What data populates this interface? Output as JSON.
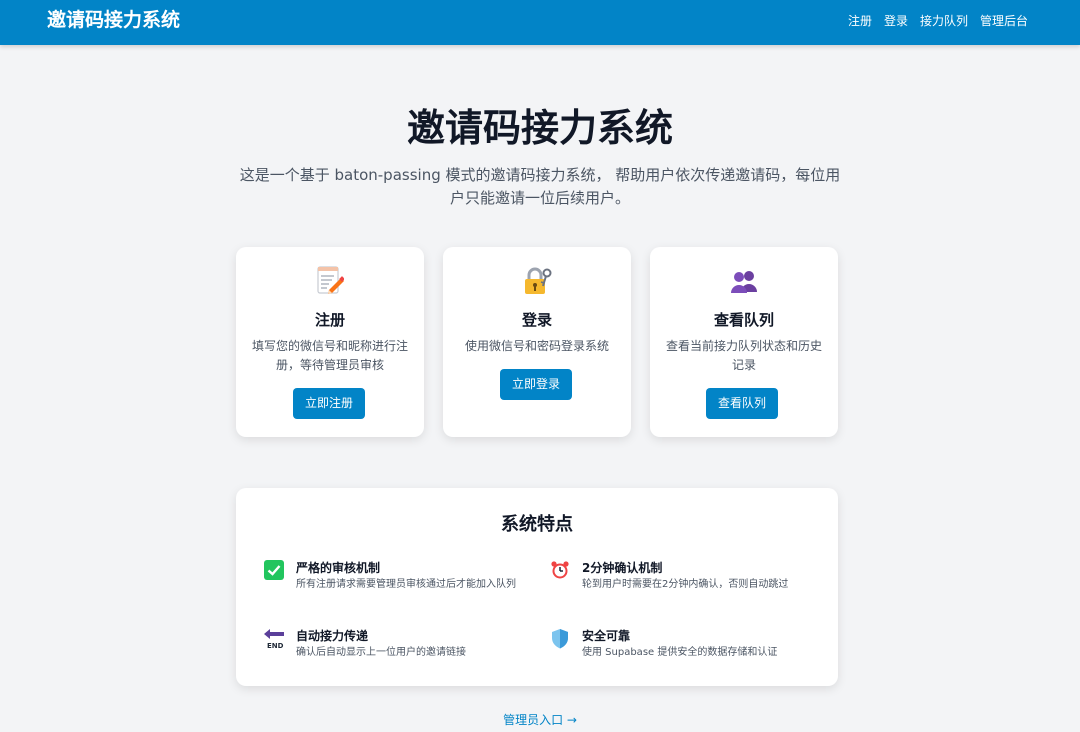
{
  "header": {
    "brand": "邀请码接力系统",
    "nav": [
      {
        "label": "注册"
      },
      {
        "label": "登录"
      },
      {
        "label": "接力队列"
      },
      {
        "label": "管理后台"
      }
    ]
  },
  "hero": {
    "title": "邀请码接力系统",
    "description": "这是一个基于 baton-passing 模式的邀请码接力系统， 帮助用户依次传递邀请码，每位用户只能邀请一位后续用户。"
  },
  "cards": [
    {
      "icon": "memo-icon",
      "title": "注册",
      "description": "填写您的微信号和昵称进行注册，等待管理员审核",
      "button": "立即注册"
    },
    {
      "icon": "lock-with-key-icon",
      "title": "登录",
      "description": "使用微信号和密码登录系统",
      "button": "立即登录"
    },
    {
      "icon": "people-icon",
      "title": "查看队列",
      "description": "查看当前接力队列状态和历史记录",
      "button": "查看队列"
    }
  ],
  "features": {
    "title": "系统特点",
    "items": [
      {
        "icon": "check-mark-icon",
        "title": "严格的审核机制",
        "description": "所有注册请求需要管理员审核通过后才能加入队列"
      },
      {
        "icon": "alarm-clock-icon",
        "title": "2分钟确认机制",
        "description": "轮到用户时需要在2分钟内确认，否则自动跳过"
      },
      {
        "icon": "end-arrow-icon",
        "title": "自动接力传递",
        "description": "确认后自动显示上一位用户的邀请链接"
      },
      {
        "icon": "shield-icon",
        "title": "安全可靠",
        "description": "使用 Supabase 提供安全的数据存储和认证"
      }
    ]
  },
  "footer": {
    "admin_link": "管理员入口 →"
  },
  "colors": {
    "primary": "#0284c7",
    "background": "#f3f4f6",
    "card": "#ffffff",
    "check_green": "#22c55e"
  }
}
